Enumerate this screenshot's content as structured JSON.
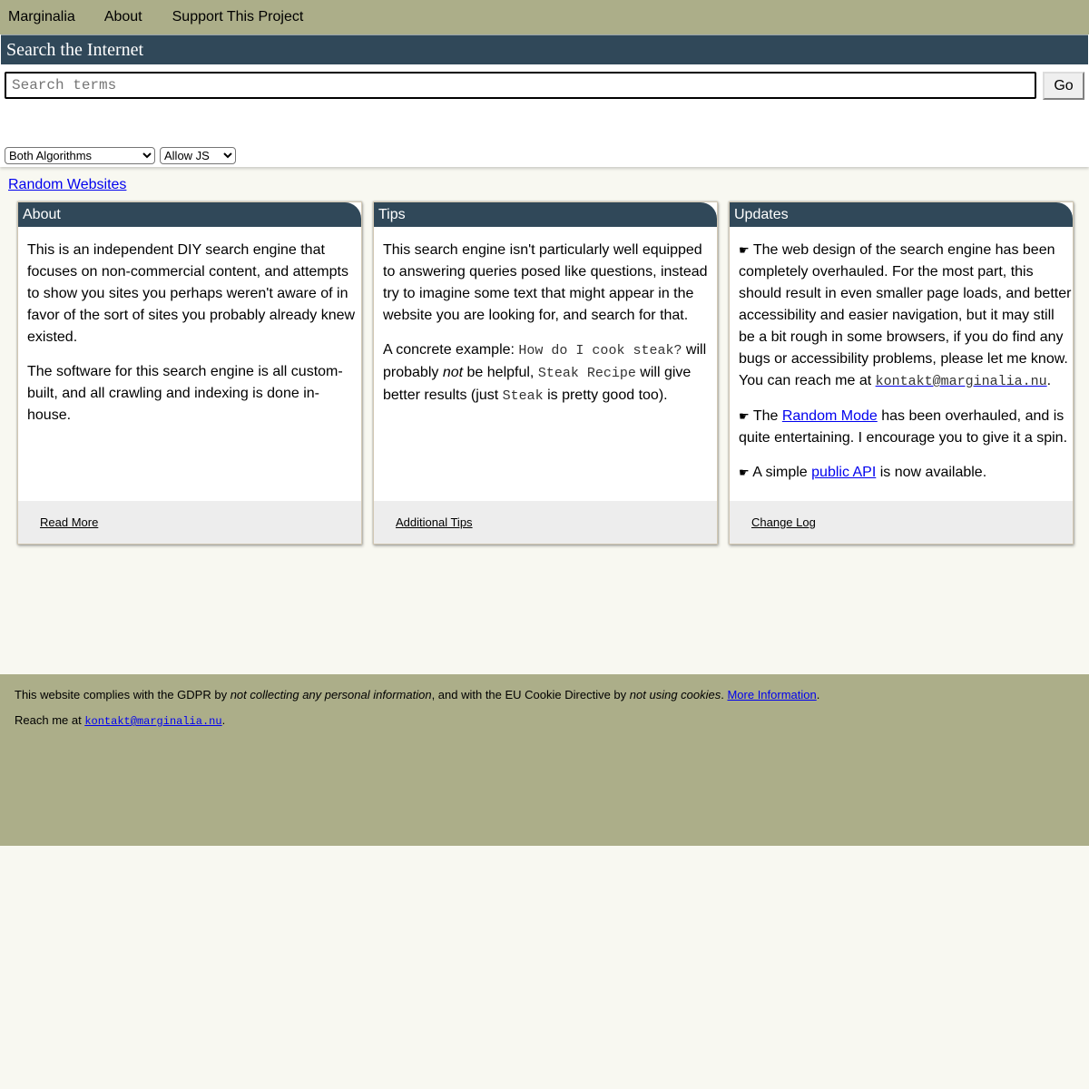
{
  "nav": {
    "items": [
      "Marginalia",
      "About",
      "Support This Project"
    ]
  },
  "search": {
    "title": "Search the Internet",
    "placeholder": "Search terms",
    "go_label": "Go",
    "algorithm_selected": "Both Algorithms",
    "js_selected": "Allow JS",
    "random_link": "Random Websites"
  },
  "cards": {
    "about": {
      "title": "About",
      "p1": "This is an independent DIY search engine that focuses on non-commercial content, and attempts to show you sites you perhaps weren't aware of in favor of the sort of sites you probably already knew existed.",
      "p2": "The software for this search engine is all custom-built, and all crawling and indexing is done in-house.",
      "footer_link": "Read More"
    },
    "tips": {
      "title": "Tips",
      "p1": "This search engine isn't particularly well equipped to answering queries posed like questions, instead try to imagine some text that might appear in the website you are looking for, and search for that.",
      "p2_a": "A concrete example: ",
      "p2_code1": "How do I cook steak?",
      "p2_b": " will probably ",
      "p2_em": "not",
      "p2_c": " be helpful, ",
      "p2_code2": "Steak Recipe",
      "p2_d": " will give better results (just ",
      "p2_code3": "Steak",
      "p2_e": " is pretty good too).",
      "footer_link": "Additional Tips"
    },
    "updates": {
      "title": "Updates",
      "bullet": "☛",
      "u1_text": " The web design of the search engine has been completely overhauled. For the most part, this should result in even smaller page loads, and better accessibility and easier navigation, but it may still be a bit rough in some browsers, if you do find any bugs or accessibility problems, please let me know. You can reach me at ",
      "u1_email": "kontakt@marginalia.nu",
      "u1_end": ".",
      "u2_a": " The ",
      "u2_link": "Random Mode",
      "u2_b": " has been overhauled, and is quite entertaining. I encourage you to give it a spin.",
      "u3_a": " A simple ",
      "u3_link": "public API",
      "u3_b": " is now available.",
      "footer_link": "Change Log"
    }
  },
  "footer": {
    "gdpr_a": "This website complies with the GDPR by ",
    "gdpr_em1": "not collecting any personal information",
    "gdpr_b": ", and with the EU Cookie Directive by ",
    "gdpr_em2": "not using cookies",
    "gdpr_c": ". ",
    "gdpr_link": "More Information",
    "gdpr_d": ".",
    "reach_a": "Reach me at ",
    "reach_email": "kontakt@marginalia.nu",
    "reach_b": "."
  },
  "colors": {
    "nav_bg": "#acae89",
    "header_bg": "#304859",
    "page_bg": "#f8f8f1",
    "card_footer_bg": "#ededed",
    "link": "#0000ee"
  }
}
